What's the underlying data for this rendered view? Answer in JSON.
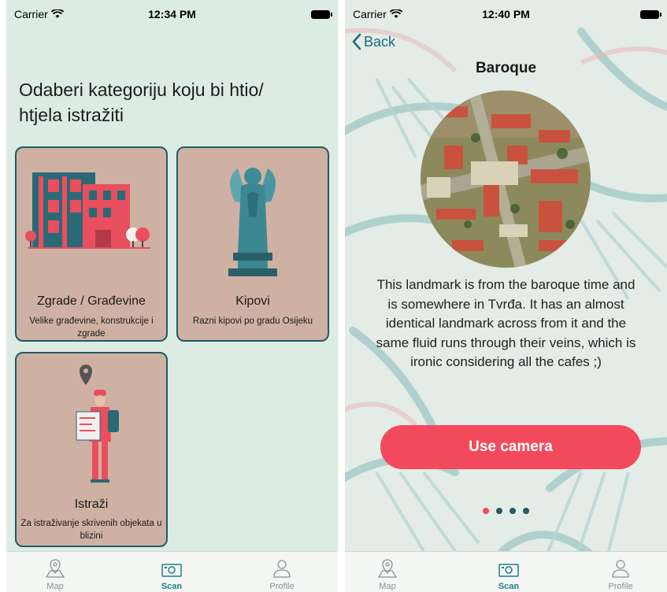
{
  "status_left": {
    "carrier": "Carrier",
    "time": "12:34 PM"
  },
  "status_right": {
    "carrier": "Carrier",
    "time": "12:40 PM"
  },
  "categories": {
    "heading": "Odaberi kategoriju koju bi htio/ htjela istražiti",
    "cards": [
      {
        "title": "Zgrade / Građevine",
        "subtitle": "Velike građevine, konstrukcije i zgrade"
      },
      {
        "title": "Kipovi",
        "subtitle": "Razni kipovi po gradu Osijeku"
      },
      {
        "title": "Istraži",
        "subtitle": "Za istraživanje skrivenih objekata u blizini"
      }
    ]
  },
  "detail": {
    "back_label": "Back",
    "title": "Baroque",
    "description": "This landmark is from the baroque time and is somewhere in Tvrđa. It has an almost identical landmark across from it and the same fluid runs through their veins, which is ironic considering all the cafes ;)",
    "button_label": "Use camera",
    "page_indicator": {
      "count": 4,
      "active_index": 0
    }
  },
  "tabbar": {
    "items": [
      {
        "label": "Map",
        "icon": "map-pin-icon"
      },
      {
        "label": "Scan",
        "icon": "scan-icon",
        "active": true
      },
      {
        "label": "Profile",
        "icon": "profile-icon"
      }
    ]
  },
  "colors": {
    "accent": "#f24a5c",
    "teal": "#1e5d63",
    "card_bg": "#cfb1a3",
    "screen_bg": "#dcebe3",
    "active_tab": "#1e7f86"
  }
}
